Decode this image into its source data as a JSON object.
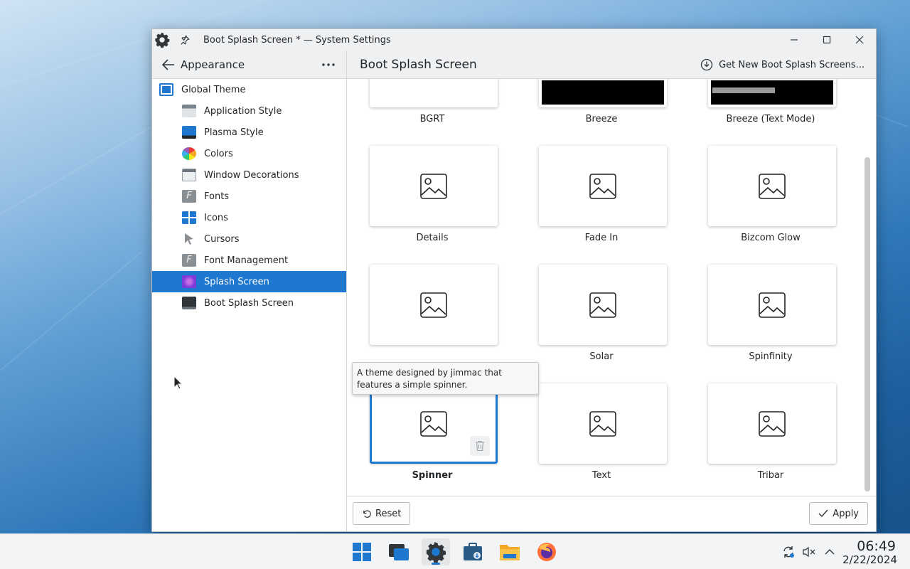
{
  "colors": {
    "accent": "#1e78d0",
    "window_bg": "#ffffff",
    "header_bg": "#eff0f1"
  },
  "window": {
    "title": "Boot Splash Screen * — System Settings",
    "app_icon": "gear-icon",
    "controls": [
      "minimize-icon",
      "maximize-icon",
      "close-icon"
    ]
  },
  "sidebar": {
    "title": "Appearance",
    "items": [
      {
        "label": "Global Theme",
        "icon": "global-theme-icon",
        "level": "top",
        "selected": false
      },
      {
        "label": "Application Style",
        "icon": "application-style-icon",
        "level": "sub",
        "selected": false
      },
      {
        "label": "Plasma Style",
        "icon": "plasma-style-icon",
        "level": "sub",
        "selected": false
      },
      {
        "label": "Colors",
        "icon": "colors-icon",
        "level": "sub",
        "selected": false
      },
      {
        "label": "Window Decorations",
        "icon": "window-decorations-icon",
        "level": "sub",
        "selected": false
      },
      {
        "label": "Fonts",
        "icon": "fonts-icon",
        "level": "sub",
        "selected": false
      },
      {
        "label": "Icons",
        "icon": "icons-icon",
        "level": "sub",
        "selected": false
      },
      {
        "label": "Cursors",
        "icon": "cursors-icon",
        "level": "sub",
        "selected": false
      },
      {
        "label": "Font Management",
        "icon": "font-management-icon",
        "level": "sub",
        "selected": false
      },
      {
        "label": "Splash Screen",
        "icon": "splash-screen-icon",
        "level": "sub",
        "selected": true
      },
      {
        "label": "Boot Splash Screen",
        "icon": "boot-splash-icon",
        "level": "sub",
        "selected": false
      }
    ]
  },
  "main": {
    "title": "Boot Splash Screen",
    "get_new_label": "Get New Boot Splash Screens...",
    "themes": [
      {
        "label": "BGRT",
        "preview": "blank"
      },
      {
        "label": "Breeze",
        "preview": "black"
      },
      {
        "label": "Breeze (Text Mode)",
        "preview": "black-text"
      },
      {
        "label": "Details",
        "preview": "image-placeholder"
      },
      {
        "label": "Fade In",
        "preview": "image-placeholder"
      },
      {
        "label": "Bizcom Glow",
        "preview": "image-placeholder"
      },
      {
        "label": "",
        "preview": "image-placeholder"
      },
      {
        "label": "Solar",
        "preview": "image-placeholder"
      },
      {
        "label": "Spinfinity",
        "preview": "image-placeholder"
      },
      {
        "label": "Spinner",
        "preview": "image-placeholder",
        "selected": true
      },
      {
        "label": "Text",
        "preview": "image-placeholder"
      },
      {
        "label": "Tribar",
        "preview": "image-placeholder"
      }
    ],
    "tooltip": "A theme designed by jimmac that features a simple spinner.",
    "reset_label": "Reset",
    "apply_label": "Apply"
  },
  "taskbar": {
    "apps": [
      "start-menu-icon",
      "overview-icon",
      "system-settings-icon",
      "discover-icon",
      "file-manager-icon",
      "firefox-icon"
    ],
    "tray": [
      "update-icon",
      "volume-muted-icon",
      "tray-expand-icon"
    ],
    "time": "06:49",
    "date": "2/22/2024"
  }
}
